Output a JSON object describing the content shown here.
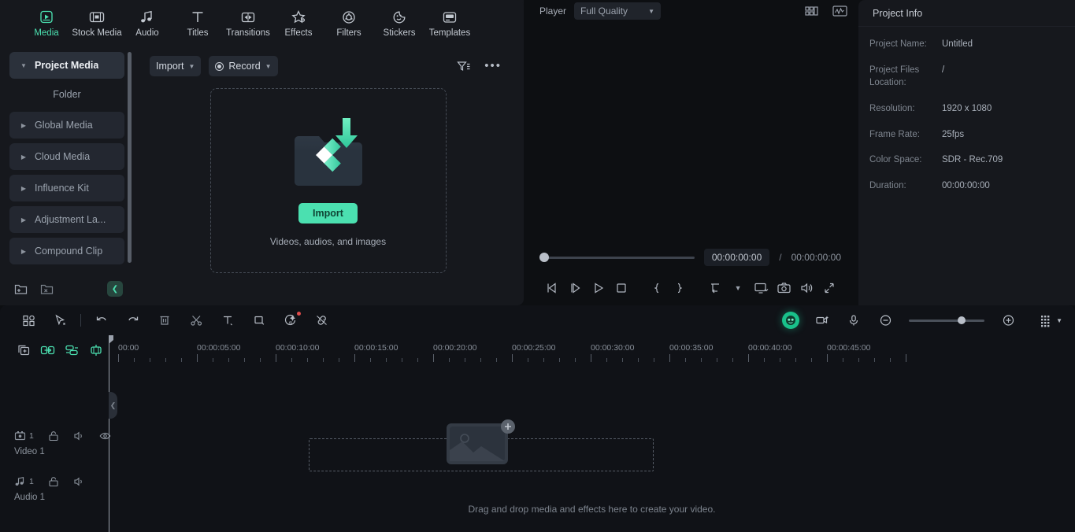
{
  "main_tabs": [
    {
      "label": "Media",
      "icon": "media-icon",
      "active": true
    },
    {
      "label": "Stock Media",
      "icon": "stock-media-icon",
      "active": false
    },
    {
      "label": "Audio",
      "icon": "audio-icon",
      "active": false
    },
    {
      "label": "Titles",
      "icon": "titles-icon",
      "active": false
    },
    {
      "label": "Transitions",
      "icon": "transitions-icon",
      "active": false
    },
    {
      "label": "Effects",
      "icon": "effects-icon",
      "active": false
    },
    {
      "label": "Filters",
      "icon": "filters-icon",
      "active": false
    },
    {
      "label": "Stickers",
      "icon": "stickers-icon",
      "active": false
    },
    {
      "label": "Templates",
      "icon": "templates-icon",
      "active": false
    }
  ],
  "sidebar": {
    "items": [
      {
        "label": "Project Media",
        "selected": true
      },
      {
        "label": "Global Media",
        "selected": false
      },
      {
        "label": "Cloud Media",
        "selected": false
      },
      {
        "label": "Influence Kit",
        "selected": false
      },
      {
        "label": "Adjustment La...",
        "selected": false
      },
      {
        "label": "Compound Clip",
        "selected": false
      }
    ],
    "folder_label": "Folder",
    "new_folder_icon": "new-folder-icon",
    "delete_folder_icon": "delete-folder-icon",
    "collapse_icon": "chevron-left-icon"
  },
  "import_bar": {
    "import_label": "Import",
    "record_label": "Record",
    "filter_icon": "filter-icon",
    "more_icon": "more-options-icon"
  },
  "dropzone": {
    "button_label": "Import",
    "caption": "Videos, audios, and images"
  },
  "player": {
    "label": "Player",
    "quality": "Full Quality",
    "layout_icon": "layout-grid-icon",
    "scope_icon": "waveform-scope-icon",
    "current_time": "00:00:00:00",
    "separator": "/",
    "total_time": "00:00:00:00",
    "controls": [
      {
        "name": "prev-frame-button",
        "glyph": "prev-frame-icon"
      },
      {
        "name": "next-frame-button",
        "glyph": "next-frame-icon"
      },
      {
        "name": "play-button",
        "glyph": "play-icon"
      },
      {
        "name": "stop-button",
        "glyph": "stop-icon"
      },
      {
        "name": "mark-in-button",
        "glyph": "brace-open-icon"
      },
      {
        "name": "mark-out-button",
        "glyph": "brace-close-icon"
      },
      {
        "name": "export-frame-button",
        "glyph": "export-icon"
      },
      {
        "name": "export-dropdown",
        "glyph": "chevron-down-icon"
      },
      {
        "name": "display-button",
        "glyph": "monitor-icon"
      },
      {
        "name": "snapshot-button",
        "glyph": "camera-icon"
      },
      {
        "name": "volume-button",
        "glyph": "speaker-icon"
      },
      {
        "name": "fullscreen-button",
        "glyph": "fullscreen-icon"
      }
    ]
  },
  "project_info": {
    "title": "Project Info",
    "rows": [
      {
        "key": "Project Name:",
        "value": "Untitled"
      },
      {
        "key": "Project Files Location:",
        "value": "/"
      },
      {
        "key": "Resolution:",
        "value": "1920 x 1080"
      },
      {
        "key": "Frame Rate:",
        "value": "25fps"
      },
      {
        "key": "Color Space:",
        "value": "SDR - Rec.709"
      },
      {
        "key": "Duration:",
        "value": "00:00:00:00"
      }
    ]
  },
  "timeline": {
    "toolbar_left": [
      {
        "name": "layout-button",
        "icon": "grid-layout-icon"
      },
      {
        "name": "select-tool-button",
        "icon": "cursor-icon"
      },
      {
        "name": "undo-button",
        "icon": "undo-icon"
      },
      {
        "name": "redo-button",
        "icon": "redo-icon"
      },
      {
        "name": "delete-button",
        "icon": "trash-icon"
      },
      {
        "name": "split-button",
        "icon": "scissors-icon"
      },
      {
        "name": "text-button",
        "icon": "text-icon"
      },
      {
        "name": "crop-button",
        "icon": "crop-icon"
      },
      {
        "name": "ai-tools-button",
        "icon": "ai-magic-icon"
      },
      {
        "name": "unlink-button",
        "icon": "unlink-icon"
      }
    ],
    "toolbar_right": [
      {
        "name": "ai-copilot-button",
        "icon": "ai-copilot-icon"
      },
      {
        "name": "screen-record-button",
        "icon": "video-capture-icon"
      },
      {
        "name": "voiceover-button",
        "icon": "microphone-icon"
      },
      {
        "name": "zoom-out-button",
        "icon": "zoom-out-icon"
      },
      {
        "name": "zoom-in-button",
        "icon": "zoom-in-icon"
      },
      {
        "name": "track-settings-button",
        "icon": "track-settings-icon"
      }
    ],
    "track_tools": [
      {
        "name": "add-track-button",
        "icon": "add-track-icon",
        "green": false
      },
      {
        "name": "auto-match-button",
        "icon": "link-arrow-icon",
        "green": true
      },
      {
        "name": "rearrange-button",
        "icon": "rearrange-icon",
        "green": true
      },
      {
        "name": "markers-button",
        "icon": "marker-icon",
        "green": true
      }
    ],
    "ruler_labels": [
      "00:00",
      "00:00:05:00",
      "00:00:10:00",
      "00:00:15:00",
      "00:00:20:00",
      "00:00:25:00",
      "00:00:30:00",
      "00:00:35:00",
      "00:00:40:00",
      "00:00:45:00"
    ],
    "tracks": [
      {
        "name": "Video 1",
        "index": "1",
        "icon": "video-track-icon",
        "controls": [
          "lock-icon",
          "mute-icon",
          "eye-icon"
        ]
      },
      {
        "name": "Audio 1",
        "index": "1",
        "icon": "audio-track-icon",
        "controls": [
          "lock-icon",
          "mute-icon"
        ]
      }
    ],
    "drop_hint": "Drag and drop media and effects here to create your video.",
    "panel_handle_icon": "collapse-handle-icon"
  },
  "colors": {
    "accent": "#4be0b0",
    "panel_bg": "#16181d",
    "app_bg": "#0d0f12",
    "timeline_bg": "#101217",
    "text": "#c9ced6",
    "muted": "#8d949e"
  }
}
